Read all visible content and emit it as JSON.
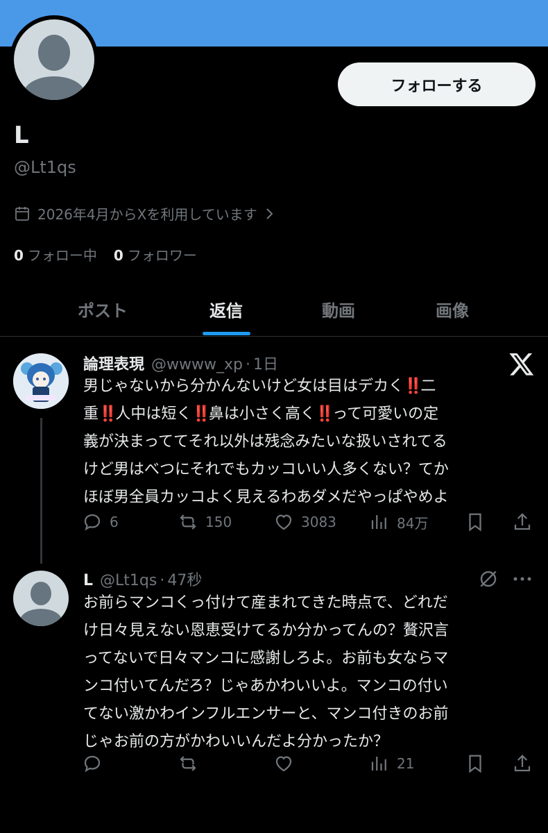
{
  "profile": {
    "follow_label": "フォローする",
    "display_name": "L",
    "handle": "@Lt1qs",
    "joined_text": "2026年4月からXを利用しています",
    "following_count": "0",
    "following_label": "フォロー中",
    "followers_count": "0",
    "followers_label": "フォロワー"
  },
  "tabs": [
    {
      "label": "ポスト"
    },
    {
      "label": "返信"
    },
    {
      "label": "動画"
    },
    {
      "label": "画像"
    }
  ],
  "tweets": [
    {
      "name": "論理表現",
      "handle": "@wwww_xp",
      "time": "1日",
      "text": "男じゃないから分かんないけど女は目はデカく‼️二重‼️人中は短く‼️鼻は小さく高く‼️って可愛いの定義が決まっててそれ以外は残念みたいな扱いされてるけど男はべつにそれでもカッコいい人多くない？てかほぼ男全員カッコよく見えるわあダメだやっぱやめよ",
      "lines": [
        "男じゃないから分かんないけど女は目はデカく",
        "‼️",
        "二",
        "重",
        "‼️",
        "人中は短く",
        "‼️",
        "鼻は小さく高く",
        "‼️",
        "って可愛いの定",
        "義が決まっててそれ以外は残念みたいな扱いされてる",
        "けど男はべつにそれでもカッコいい人多くない？てか",
        "ほぼ男全員カッコよく見えるわあダメだやっぱやめよ"
      ],
      "replies": "6",
      "reposts": "150",
      "likes": "3083",
      "views": "84万",
      "badge_icon": "x-logo-icon"
    },
    {
      "name": "L",
      "handle": "@Lt1qs",
      "time": "47秒",
      "text": "お前らマンコくっ付けて産まれてきた時点で、どれだけ日々見えない恩恵受けてるか分かってんの？贅沢言ってないで日々マンコに感謝しろよ。お前も女ならマンコ付いてんだろ？じゃあかわいいよ。マンコの付いてない激かわインフルエンサーと、マンコ付きのお前じゃお前の方がかわいいんだよ分かったか？",
      "lines": [
        "お前らマンコくっ付けて産まれてきた時点で、どれだ",
        "け日々見えない恩恵受けてるか分かってんの？贅沢言",
        "ってないで日々マンコに感謝しろよ。お前も女ならマ",
        "ンコ付いてんだろ？じゃあかわいいよ。マンコの付い",
        "てない激かわインフルエンサーと、マンコ付きのお前",
        "じゃお前の方がかわいいんだよ分かったか？"
      ],
      "views": "21"
    }
  ],
  "colors": {
    "banner": "#4a99e9",
    "accent": "#1d9bf0",
    "muted": "#71767b",
    "text": "#e7e9ea",
    "alert": "#e0182d"
  }
}
